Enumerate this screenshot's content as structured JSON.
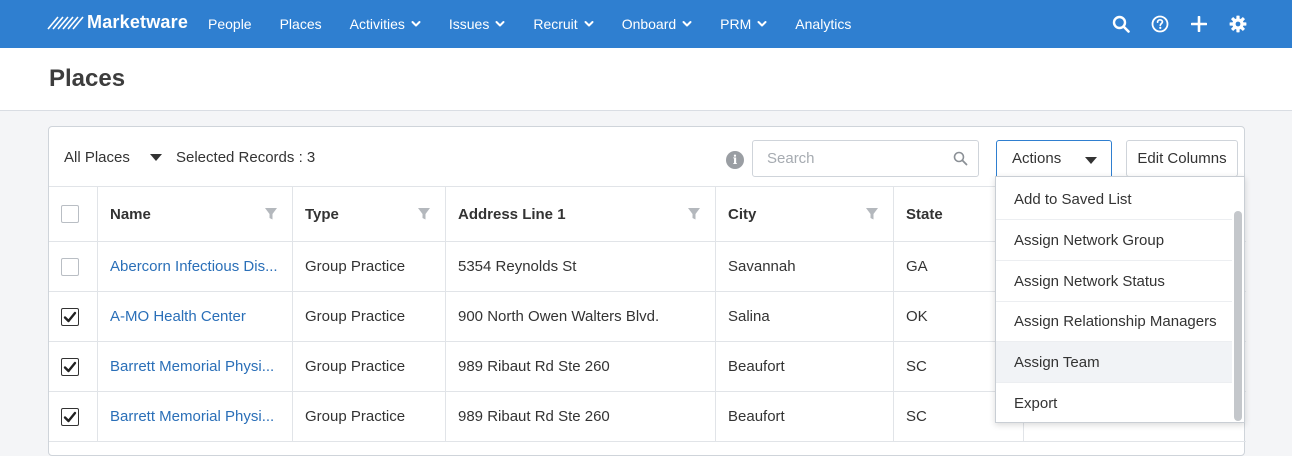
{
  "app": {
    "brand": "Marketware",
    "nav": [
      {
        "label": "People",
        "dropdown": false
      },
      {
        "label": "Places",
        "dropdown": false
      },
      {
        "label": "Activities",
        "dropdown": true
      },
      {
        "label": "Issues",
        "dropdown": true
      },
      {
        "label": "Recruit",
        "dropdown": true
      },
      {
        "label": "Onboard",
        "dropdown": true
      },
      {
        "label": "PRM",
        "dropdown": true
      },
      {
        "label": "Analytics",
        "dropdown": false
      }
    ],
    "nav_icons": [
      "search-icon",
      "help-icon",
      "plus-icon",
      "gear-icon"
    ],
    "accent_color": "#2f7fd0",
    "link_color": "#2a6fb8"
  },
  "page": {
    "title": "Places"
  },
  "toolbar": {
    "view_select": "All Places",
    "selected_records": "Selected Records : 3",
    "search_placeholder": "Search",
    "search_value": "",
    "actions_label": "Actions",
    "edit_columns_label": "Edit Columns"
  },
  "table": {
    "columns": [
      "Name",
      "Type",
      "Address Line 1",
      "City",
      "State"
    ],
    "rows": [
      {
        "checked": false,
        "name": "Abercorn Infectious Dis...",
        "type": "Group Practice",
        "address": "5354 Reynolds St",
        "city": "Savannah",
        "state": "GA"
      },
      {
        "checked": true,
        "name": "A-MO Health Center",
        "type": "Group Practice",
        "address": "900 North Owen Walters Blvd.",
        "city": "Salina",
        "state": "OK"
      },
      {
        "checked": true,
        "name": "Barrett Memorial Physi...",
        "type": "Group Practice",
        "address": "989 Ribaut Rd Ste 260",
        "city": "Beaufort",
        "state": "SC"
      },
      {
        "checked": true,
        "name": "Barrett Memorial Physi...",
        "type": "Group Practice",
        "address": "989 Ribaut Rd Ste 260",
        "city": "Beaufort",
        "state": "SC"
      }
    ]
  },
  "actions_menu": {
    "items": [
      "Add to Saved List",
      "Assign Network Group",
      "Assign Network Status",
      "Assign Relationship Managers",
      "Assign Team",
      "Export"
    ],
    "highlighted": "Assign Team"
  }
}
